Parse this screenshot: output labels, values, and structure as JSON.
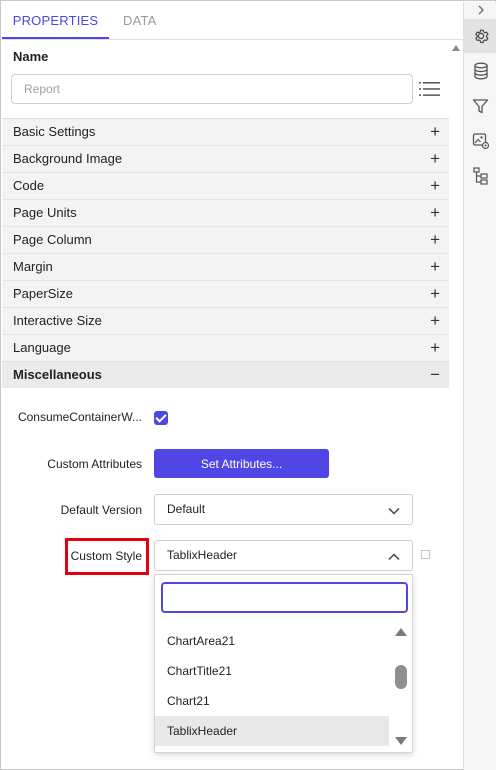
{
  "tabs": {
    "properties": "PROPERTIES",
    "data": "DATA"
  },
  "name": {
    "label": "Name",
    "placeholder": "Report"
  },
  "sections": [
    {
      "label": "Basic Settings",
      "sign": "+"
    },
    {
      "label": "Background Image",
      "sign": "+"
    },
    {
      "label": "Code",
      "sign": "+"
    },
    {
      "label": "Page Units",
      "sign": "+"
    },
    {
      "label": "Page Column",
      "sign": "+"
    },
    {
      "label": "Margin",
      "sign": "+"
    },
    {
      "label": "PaperSize",
      "sign": "+"
    },
    {
      "label": "Interactive Size",
      "sign": "+"
    },
    {
      "label": "Language",
      "sign": "+"
    },
    {
      "label": "Miscellaneous",
      "sign": "−"
    }
  ],
  "misc": {
    "consume_label": "ConsumeContainerW...",
    "consume_checked": true,
    "custom_attributes_label": "Custom Attributes",
    "set_attributes_button": "Set Attributes...",
    "default_version_label": "Default Version",
    "default_version_value": "Default",
    "custom_style_label": "Custom Style",
    "custom_style_value": "TablixHeader"
  },
  "dropdown": {
    "search_value": "",
    "options": [
      "ChartArea21",
      "ChartTitle21",
      "Chart21",
      "TablixHeader"
    ],
    "selected": "TablixHeader"
  },
  "rail": {
    "icons": [
      "chevron-right-icon",
      "gear-icon",
      "database-icon",
      "filter-icon",
      "image-settings-icon",
      "tree-icon"
    ]
  },
  "colors": {
    "accent": "#4f46e5",
    "highlight": "#e3000f"
  }
}
